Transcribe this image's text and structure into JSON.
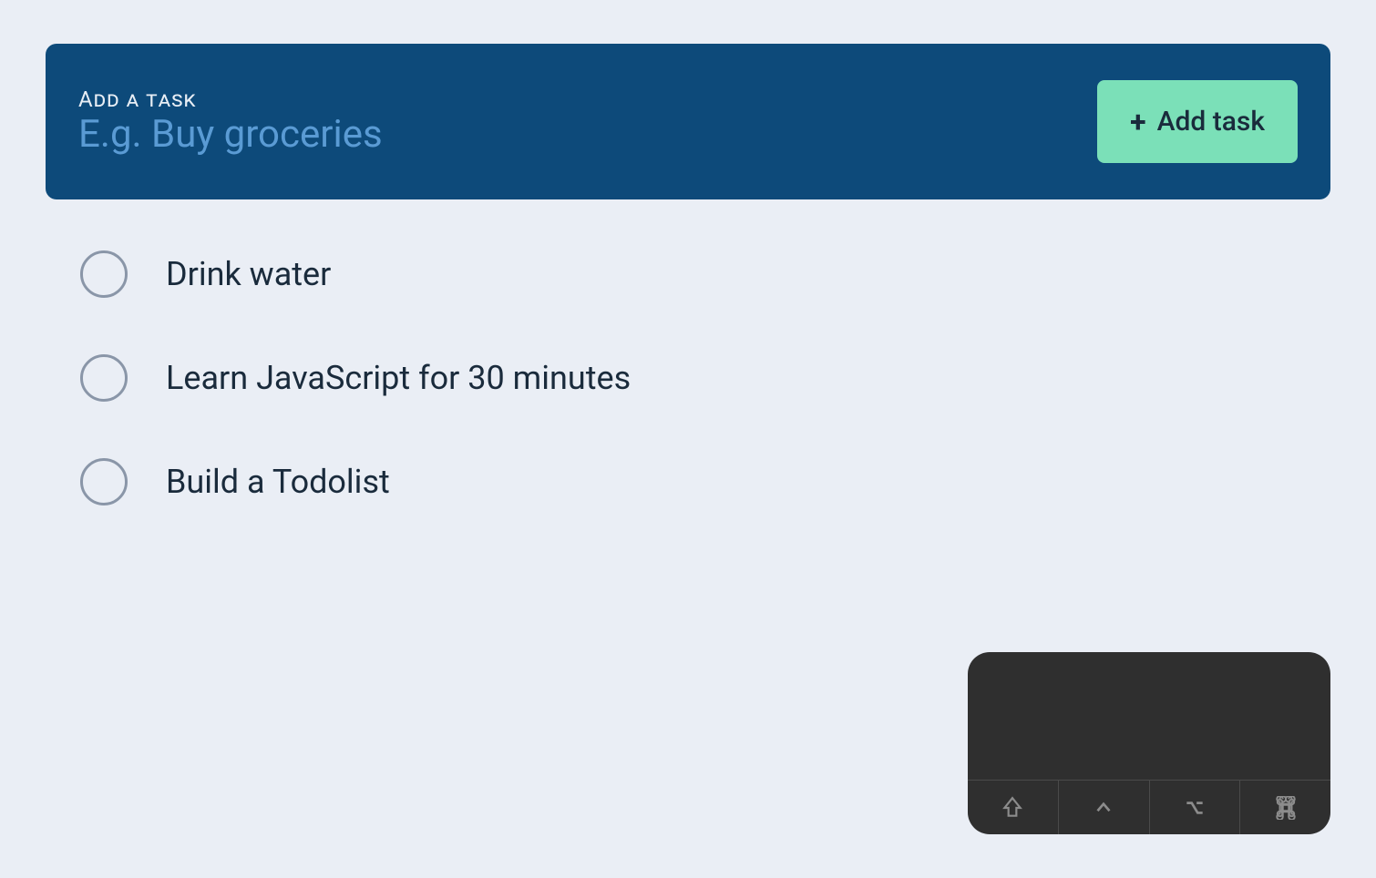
{
  "header": {
    "label": "Add a task",
    "placeholder": "E.g. Buy groceries",
    "value": "",
    "button_label": "Add task"
  },
  "tasks": [
    {
      "text": "Drink water",
      "completed": false
    },
    {
      "text": "Learn JavaScript for 30 minutes",
      "completed": false
    },
    {
      "text": "Build a Todolist",
      "completed": false
    }
  ],
  "keyboard": {
    "keys": [
      "shift",
      "control",
      "option",
      "command"
    ]
  }
}
